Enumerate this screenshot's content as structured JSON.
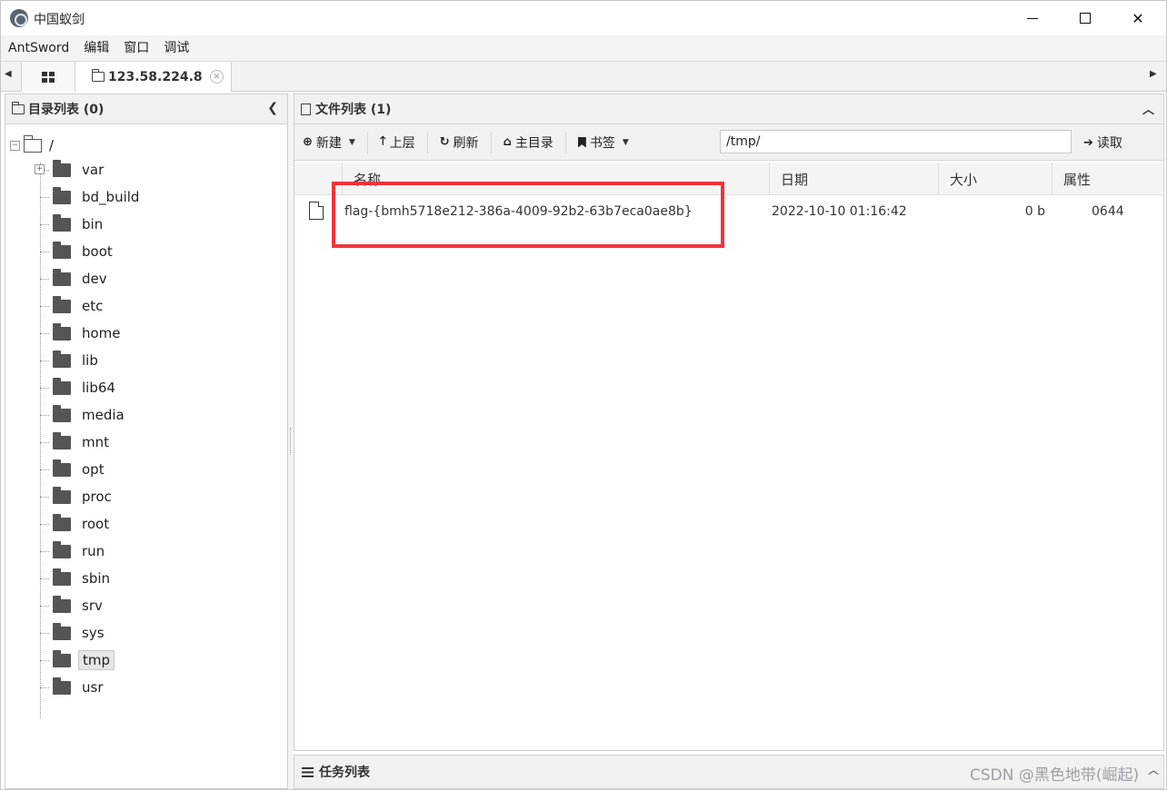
{
  "window": {
    "title": "中国蚁剑"
  },
  "menu": [
    "AntSword",
    "编辑",
    "窗口",
    "调试"
  ],
  "tabs": {
    "session_label": "123.58.224.8",
    "close_glyph": "×"
  },
  "left_panel": {
    "title": "目录列表 (0)",
    "root_label": "/",
    "folders": [
      "var",
      "bd_build",
      "bin",
      "boot",
      "dev",
      "etc",
      "home",
      "lib",
      "lib64",
      "media",
      "mnt",
      "opt",
      "proc",
      "root",
      "run",
      "sbin",
      "srv",
      "sys",
      "tmp",
      "usr"
    ],
    "selected": "tmp"
  },
  "right_panel": {
    "title": "文件列表 (1)",
    "toolbar": {
      "new": "新建",
      "up": "上层",
      "refresh": "刷新",
      "home": "主目录",
      "bookmark": "书签",
      "path_value": "/tmp/",
      "read": "读取"
    },
    "columns": {
      "name": "名称",
      "date": "日期",
      "size": "大小",
      "attr": "属性"
    },
    "files": [
      {
        "name": "flag-{bmh5718e212-386a-4009-92b2-63b7eca0ae8b}",
        "date": "2022-10-10 01:16:42",
        "size": "0 b",
        "attr": "0644"
      }
    ]
  },
  "tasks": {
    "title": "任务列表"
  },
  "watermark": "CSDN @黑色地带(崛起)",
  "colors": {
    "highlight": "#f0333a",
    "panel_header": "#f1f1f1"
  }
}
